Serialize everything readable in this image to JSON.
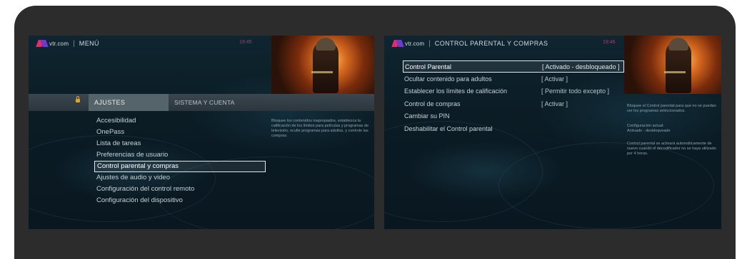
{
  "left_screen": {
    "brand": "vtr.com",
    "title": "MENÚ",
    "clock": "19:45",
    "tabs": {
      "active": "AJUSTES",
      "inactive": "SISTEMA Y CUENTA"
    },
    "menu_items": [
      "Accesibilidad",
      "OnePass",
      "Lista de tareas",
      "Preferencias de usuario",
      "Control parental y compras",
      "Ajustes de audio y video",
      "Configuración del control remoto",
      "Configuración del dispositivo"
    ],
    "selected_index": 4,
    "description": "Bloquee los contenidos inapropiados, establezca la calificación de los límites para películas y programas de televisión, oculte programas para adultos, y controle las compras."
  },
  "right_screen": {
    "brand": "vtr.com",
    "title": "CONTROL PARENTAL Y COMPRAS",
    "clock": "19:46",
    "rows": [
      {
        "label": "Control Parental",
        "value": "[ Activado - desbloqueado ]"
      },
      {
        "label": "Ocultar contenido para adultos",
        "value": "[ Activar ]"
      },
      {
        "label": "Establecer los límites de calificación",
        "value": "[ Permitir todo excepto ]"
      },
      {
        "label": "Control de compras",
        "value": "[ Activar ]"
      },
      {
        "label": "Cambiar su PIN",
        "value": ""
      },
      {
        "label": "Deshabilitar el Control parental",
        "value": ""
      }
    ],
    "selected_index": 0,
    "description_1": "Bloquee el Control parental para que no se puedan ver los programas seleccionados.",
    "description_2": "Configuración actual:",
    "description_3": "Activado - desbloqueado",
    "description_4": "Control parental se activará automáticamente de nuevo cuando el decodificador no se haya utilizado por 4 horas."
  }
}
